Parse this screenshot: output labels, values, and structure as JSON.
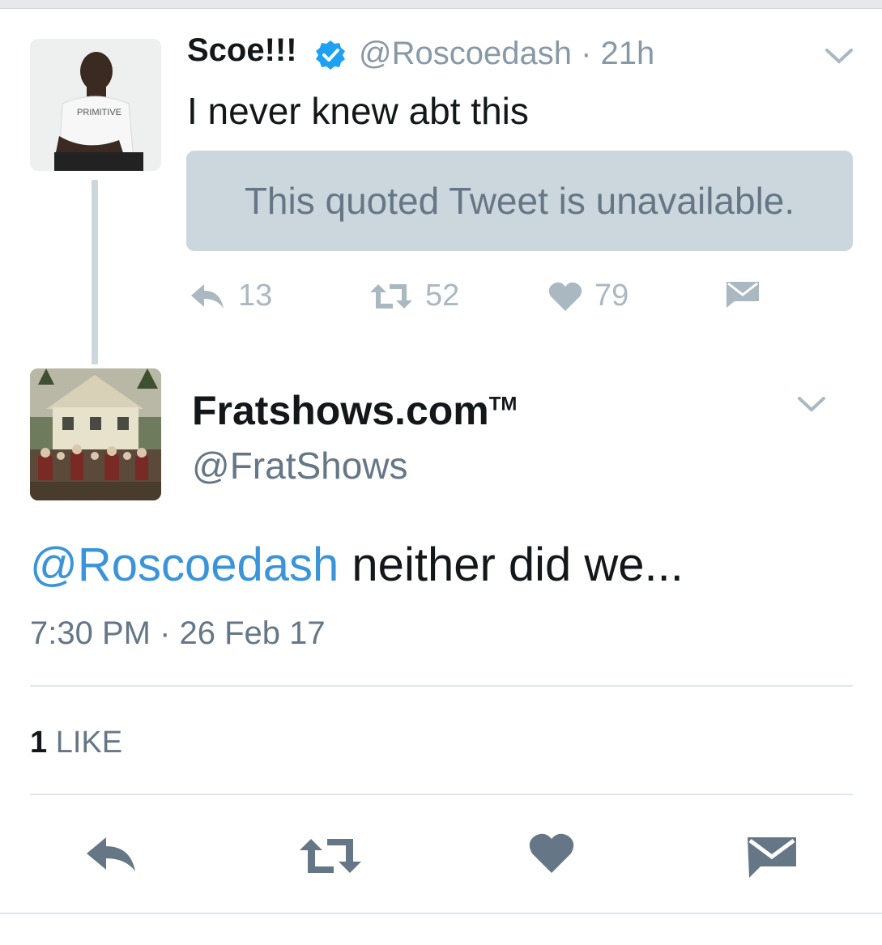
{
  "colors": {
    "link": "#3b94d9",
    "verified": "#1da1f2",
    "secondary": "#657786",
    "icon": "#aab8c2",
    "action_icon": "#657786"
  },
  "original_tweet": {
    "author_name": "Scoe!!!",
    "verified": true,
    "handle": "@Roscoedash",
    "time": "· 21h",
    "text": "I never knew abt this",
    "quoted_tweet": "This quoted Tweet is unavailable.",
    "avatar_shirt_text": "PRIMITIVE",
    "actions": {
      "replies": "13",
      "retweets": "52",
      "likes": "79"
    }
  },
  "reply_tweet": {
    "author_name": "Fratshows.com",
    "trademark": "TM",
    "handle": "@FratShows",
    "mention": "@Roscoedash",
    "text": " neither did we...",
    "timestamp": "7:30 PM · 26 Feb 17",
    "like_count": "1",
    "like_label": "LIKE"
  },
  "icons": [
    "chevron-down-icon",
    "verified-badge-icon",
    "reply-icon",
    "retweet-icon",
    "heart-icon",
    "message-icon"
  ]
}
